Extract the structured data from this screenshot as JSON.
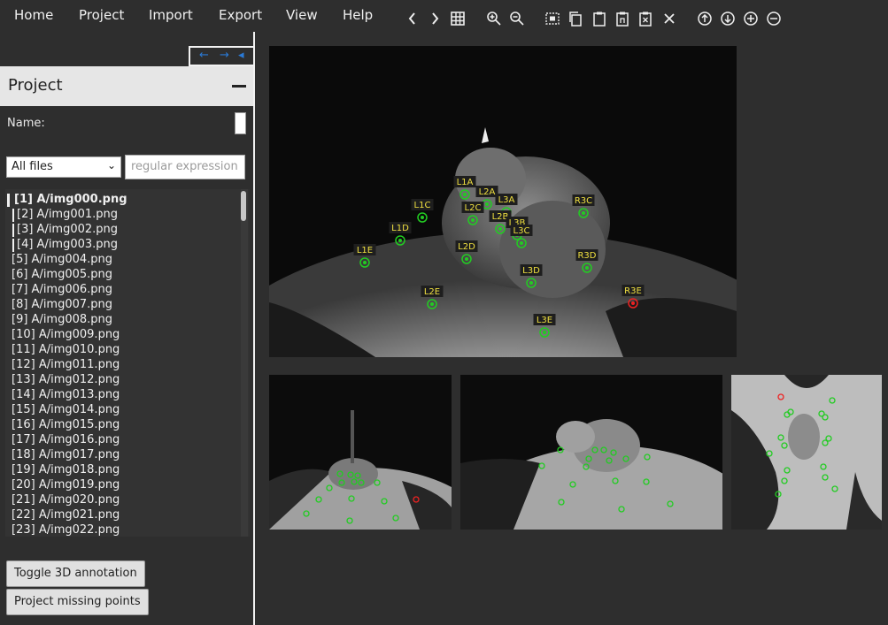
{
  "menu": [
    "Home",
    "Project",
    "Import",
    "Export",
    "View",
    "Help"
  ],
  "toolbar_icons": [
    "chevron-left-icon",
    "chevron-right-icon",
    "grid-icon",
    "zoom-in-icon",
    "zoom-out-icon",
    "select-frame-icon",
    "copy-icon",
    "paste-icon",
    "paste-n-icon",
    "clear-icon",
    "close-icon",
    "arrow-up-circle-icon",
    "arrow-down-circle-icon",
    "plus-circle-icon",
    "minus-circle-icon"
  ],
  "sidebar": {
    "arrows": [
      "←",
      "→",
      "◂"
    ],
    "panel_title": "Project",
    "name_label": "Name:",
    "filter_select": "All files",
    "regex_placeholder": "regular expression",
    "files": [
      "[1] A/img000.png",
      "[2] A/img001.png",
      "[3] A/img002.png",
      "[4] A/img003.png",
      "[5] A/img004.png",
      "[6] A/img005.png",
      "[7] A/img006.png",
      "[8] A/img007.png",
      "[9] A/img008.png",
      "[10] A/img009.png",
      "[11] A/img010.png",
      "[12] A/img011.png",
      "[13] A/img012.png",
      "[14] A/img013.png",
      "[15] A/img014.png",
      "[16] A/img015.png",
      "[17] A/img016.png",
      "[18] A/img017.png",
      "[19] A/img018.png",
      "[20] A/img019.png",
      "[21] A/img020.png",
      "[22] A/img021.png",
      "[23] A/img022.png"
    ],
    "selected_index": 0,
    "buttons": {
      "toggle_3d": "Toggle 3D annotation",
      "project_missing": "Project missing points"
    }
  },
  "viewer": {
    "keypoints": [
      {
        "label": "L1A",
        "status": "ok"
      },
      {
        "label": "L2A",
        "status": "ok"
      },
      {
        "label": "L3A",
        "status": "ok"
      },
      {
        "label": "L1C",
        "status": "ok"
      },
      {
        "label": "L2C",
        "status": "ok"
      },
      {
        "label": "L2B",
        "status": "ok"
      },
      {
        "label": "L3B",
        "status": "ok"
      },
      {
        "label": "L3C",
        "status": "ok"
      },
      {
        "label": "L1D",
        "status": "ok"
      },
      {
        "label": "L2D",
        "status": "ok"
      },
      {
        "label": "L1E",
        "status": "ok"
      },
      {
        "label": "L3D",
        "status": "ok"
      },
      {
        "label": "L2E",
        "status": "ok"
      },
      {
        "label": "L3E",
        "status": "ok"
      },
      {
        "label": "R3C",
        "status": "ok"
      },
      {
        "label": "R3D",
        "status": "ok"
      },
      {
        "label": "R3E",
        "status": "error"
      }
    ]
  },
  "colors": {
    "ok": "#22cc22",
    "error": "#ee2222",
    "label_text": "#f0e040",
    "label_bg": "#1e1e1e"
  }
}
